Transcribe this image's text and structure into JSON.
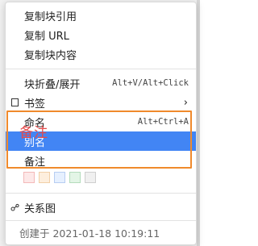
{
  "menu": {
    "items": [
      {
        "label": "复制块引用"
      },
      {
        "label": "复制 URL"
      },
      {
        "label": "复制块内容"
      }
    ],
    "fold": {
      "label": "块折叠/展开",
      "shortcut": "Alt+V/Alt+Click"
    },
    "bookmark": {
      "label": "书签",
      "icon": "bookmark-icon"
    },
    "name": {
      "label": "命名",
      "shortcut": "Alt+Ctrl+A"
    },
    "alias": {
      "label": "别名"
    },
    "memo": {
      "label": "备注"
    },
    "overlay_text": "备注",
    "colors": [
      "#fde8e8",
      "#fdeedd",
      "#e6f0ff",
      "#e3f5e6",
      "#f0f0f0"
    ],
    "relation": {
      "label": "关系图",
      "icon": "graph-icon"
    },
    "created": {
      "label": "创建于 2021-01-18 10:19:11"
    }
  },
  "colors": {
    "selected": "#4285f4",
    "highlight_box": "#f08a2c",
    "overlay_text": "#e54a4a"
  }
}
